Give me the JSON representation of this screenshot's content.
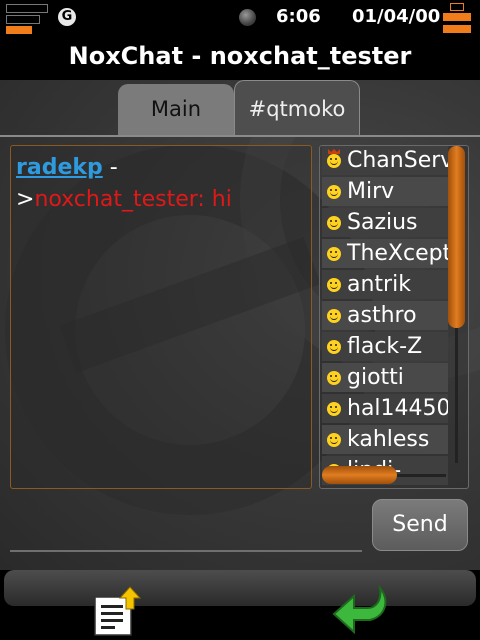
{
  "statusbar": {
    "network_letter": "G",
    "time": "6:06",
    "date": "01/04/00",
    "signal_level": 3,
    "signal_max": 5,
    "battery_level": 5,
    "battery_max": 6,
    "accent_color": "#f07c1a"
  },
  "titlebar": {
    "title": "NoxChat - noxchat_tester"
  },
  "tabs": [
    {
      "label": "Main",
      "active": false
    },
    {
      "label": "#qtmoko",
      "active": true
    }
  ],
  "chat": {
    "lines": [
      {
        "nick": "radekp",
        "separator": " -"
      },
      {
        "prefix": ">",
        "message": "noxchat_tester: hi"
      }
    ],
    "nick_color": "#2e9ae0",
    "message_color": "#e01818"
  },
  "users": [
    {
      "name": "ChanServ",
      "role": "op"
    },
    {
      "name": "Mirv",
      "role": "user"
    },
    {
      "name": "Sazius",
      "role": "user"
    },
    {
      "name": "TheXception",
      "role": "user"
    },
    {
      "name": "antrik",
      "role": "user"
    },
    {
      "name": "asthro",
      "role": "user"
    },
    {
      "name": "flack-Z",
      "role": "user"
    },
    {
      "name": "giotti",
      "role": "user"
    },
    {
      "name": "hal14450",
      "role": "user"
    },
    {
      "name": "kahless",
      "role": "user"
    },
    {
      "name": "lindi-",
      "role": "user"
    }
  ],
  "send_button": {
    "label": "Send"
  },
  "input": {
    "value": ""
  },
  "toolbar": {
    "left_icon": "document-upload-icon",
    "right_icon": "back-arrow-icon"
  }
}
